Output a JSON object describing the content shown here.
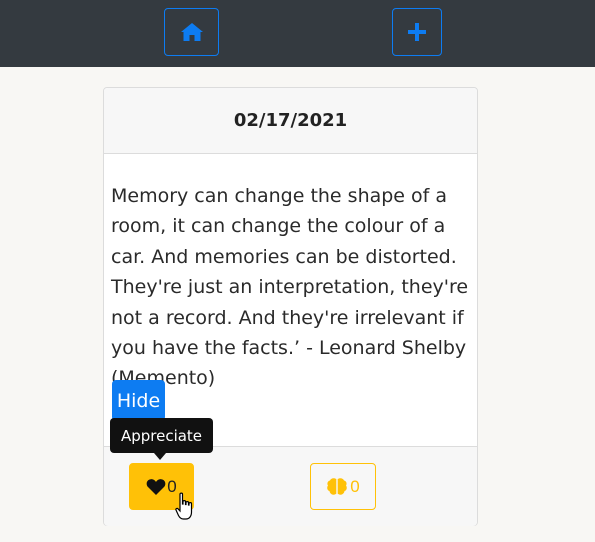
{
  "navbar": {
    "home_icon": "home-icon",
    "add_icon": "plus-icon",
    "accent": "#0d7cf2"
  },
  "card": {
    "date": "02/17/2021",
    "quote": "Memory can change the shape of a room, it can change the colour of a car. And memories can be distorted. They're just an interpretation, they're not a record. And they're irrelevant if you have the facts.’ - Leonard Shelby (Memento)",
    "hide_label": "Hide"
  },
  "footer": {
    "appreciate_count": "0",
    "brain_count": "0",
    "appreciate_icon": "heart-icon",
    "brain_icon": "brain-icon",
    "accent": "#ffc107"
  },
  "tooltip": {
    "text": "Appreciate"
  }
}
